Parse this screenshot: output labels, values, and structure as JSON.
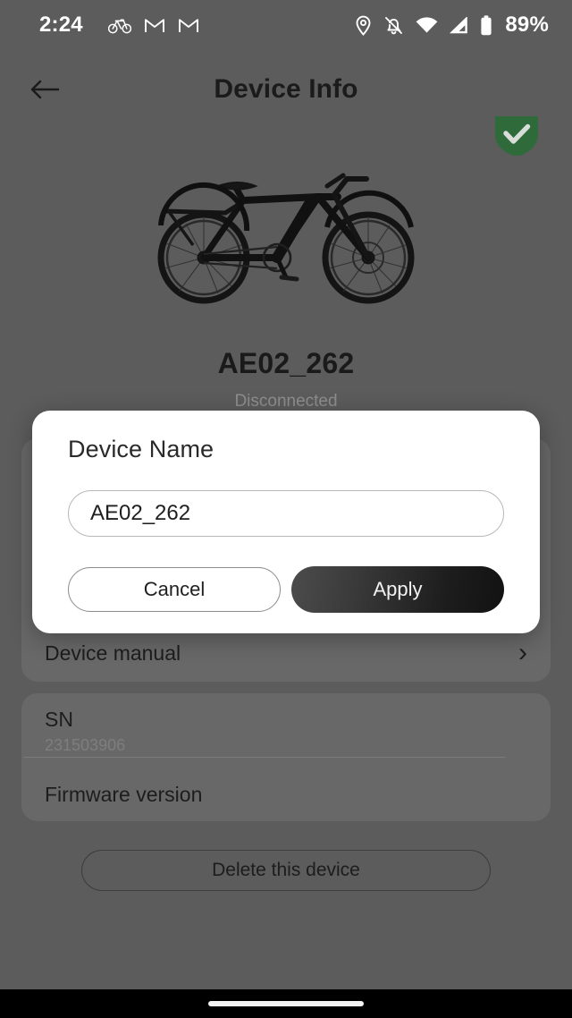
{
  "status_bar": {
    "time": "2:24",
    "battery_percent": "89%",
    "left_icons": [
      "circle-icon",
      "bicycle-icon",
      "gmail-icon",
      "gmail-icon",
      "dot-icon"
    ],
    "right_icons": [
      "location-pin-icon",
      "notifications-muted-icon",
      "wifi-icon",
      "cellular-signal-icon",
      "battery-icon"
    ]
  },
  "header": {
    "title": "Device Info",
    "back_icon": "arrow-left-icon"
  },
  "badge": {
    "icon": "verified-shield-check-icon",
    "color": "#2f6b3a"
  },
  "device": {
    "image_alt": "bicycle-product-image",
    "name": "AE02_262",
    "status": "Disconnected"
  },
  "settings_card": {
    "rows": [
      {
        "label": "Device manual",
        "chevron": "›"
      }
    ]
  },
  "info_card": {
    "sn_label": "SN",
    "sn_value": "231503906",
    "firmware_label": "Firmware version"
  },
  "delete_button": {
    "label": "Delete this device"
  },
  "dialog": {
    "title": "Device Name",
    "input_value": "AE02_262",
    "input_placeholder": "Device Name",
    "cancel_label": "Cancel",
    "apply_label": "Apply"
  },
  "nav_bar": {
    "gesture_pill": "home-gesture-pill"
  }
}
